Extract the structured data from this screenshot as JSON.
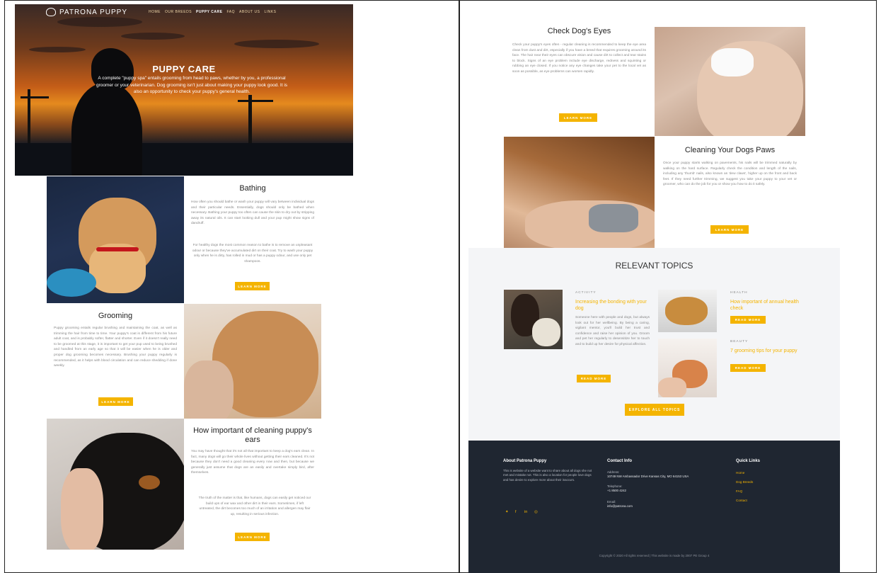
{
  "brand": {
    "name": "PATRONA PUPPY"
  },
  "nav": {
    "items": [
      "HOME",
      "OUR BREEDS",
      "PUPPY CARE",
      "FAQ",
      "ABOUT US",
      "LINKS"
    ],
    "active": "PUPPY CARE"
  },
  "hero": {
    "title": "PUPPY CARE",
    "text": "A complete \"puppy spa\" entails grooming from head to paws, whether by you, a professional groomer or your veterinarian. Dog grooming isn't just about making your puppy look good. It is also an opportunity to check your puppy's general health."
  },
  "bathing": {
    "title": "Bathing",
    "p1": "How often you should bathe or wash your puppy will vary between individual dogs and their particular needs. Essentially, dogs should only be bathed when necessary. Bathing your puppy too often can cause the skin to dry out by stripping away its natural oils. It can start looking dull and your pup might show signs of dandruff.",
    "p2": "For healthy dogs the most common reason to bathe is to remove an unpleasant odour or because they've accumulated dirt on their coat. Try to wash your puppy only when he is dirty, has rolled in mud or has a puppy odour, and use only pet shampoos.",
    "button": "LEARN MORE"
  },
  "grooming": {
    "title": "Grooming",
    "p1": "Puppy grooming entails regular brushing and maintaining the coat, as well as trimming the hair from time to time. Your puppy's coat is different from his future adult coat, and is probably softer, flatter and shorter. Even if it doesn't really need to be groomed at this stage, it is important to get your pup used to being brushed and handled from an early age so that it will be easier when he is older and proper dog grooming becomes necessary. Brushing your puppy regularly is recommended, as it helps with blood circulation and can reduce shedding if done weekly.",
    "button": "LEARN MORE"
  },
  "ears": {
    "title": "How important of cleaning puppy's ears",
    "p1": "You may have thought that it's not all that important to keep a dog's ears clean. In fact, many dogs will go their whole lives without getting their ears cleaned. It's not because they don't need a good cleaning every now and then, but because we generally just assume that dogs are an easily and overtake simply bird, after themselves.",
    "p2": "The truth of the matter is that, like humans, dogs can easily get noticed our build ups of ear wax and other dirt in their ears. Sometimes, if left untreated, the dirt becomes too much of an irritation and allergen may flair up, resulting in serious infection.",
    "button": "LEARN MORE"
  },
  "eyes": {
    "title": "Check Dog's Eyes",
    "p1": "Check your puppy's eyes often - regular cleaning is recommended to keep the eye area clean from dust and dirt, especially if you have a breed that requires grooming around its face. The hair near their eyes can obscure vision and cause dirt to collect and tear stains to block. Signs of an eye problem include eye discharge, redness and squinting or rubbing an eye closed. If you notice any eye changes take your pet to the local vet as soon as possible, as eye problems can worsen rapidly.",
    "button": "LEARN MORE"
  },
  "paws": {
    "title": "Cleaning Your Dogs Paws",
    "p1": "Once your puppy starts walking on pavements, his nails will be trimmed naturally by walking on the hard surface. Regularly check the condition and length of the nails, including any 'thumb' nails, also known as 'dew claws', higher up on the front and back feet. If they need further trimming, we suggest you take your puppy to your vet or groomer, who can do the job for you or show you how to do it safely.",
    "button": "LEARN MORE"
  },
  "topics": {
    "title": "RELEVANT TOPICS",
    "items": [
      {
        "category": "ACTIVITY",
        "title": "Increasing the bonding with your dog",
        "text": "Someone here with people and dogs, but always look out for her wellbeing. By being a caring, vigilant mentor, you'll build her trust and confidence and raise her opinion of you. Groom and pet her regularly to desensitize her to touch and to build up her desire for physical affection.",
        "button": "READ MORE"
      },
      {
        "category": "HEALTH",
        "title": "How important of annual health check",
        "button": "READ MORE"
      },
      {
        "category": "BEAUTY",
        "title": "7 grooming tips for your puppy",
        "button": "READ MORE"
      }
    ],
    "explore": "EXPLORE ALL TOPICS"
  },
  "footer": {
    "about_title": "About Patrona Puppy",
    "about_text": "This is website of a website want to share about all dogs she not met and mistake not. This is also a location for people love dogs and has desire to explore more about their inaccurs.",
    "contact_title": "Contact Info",
    "address_label": "Address:",
    "address": "10749 NW Ambassador Drive Kansas City, MO 64153 USA",
    "phone_label": "Telephone:",
    "phone": "+1 8500 4242",
    "email_label": "Email:",
    "email": "info@patrona.com",
    "links_title": "Quick Links",
    "links": [
      "Home",
      "Dog Breeds",
      "FAQ",
      "Contact"
    ],
    "social": [
      "twitter-icon",
      "facebook-icon",
      "linkedin-icon",
      "instagram-icon"
    ],
    "social_glyphs": [
      "✦",
      "f",
      "in",
      "◎"
    ],
    "copyright": "Copyright © 2020 All rights reserved | This website is made by 2007 PE Group 4"
  }
}
